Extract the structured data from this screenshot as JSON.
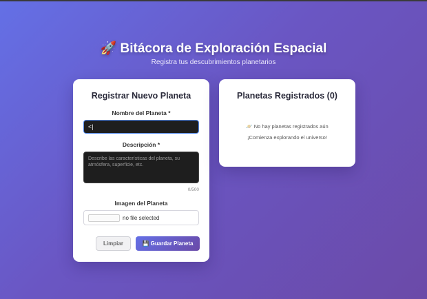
{
  "header": {
    "title": "🚀 Bitácora de Exploración Espacial",
    "subtitle": "Registra tus descubrimientos planetarios"
  },
  "form": {
    "heading": "Registrar Nuevo Planeta",
    "name_label": "Nombre del Planeta *",
    "name_value": "<|",
    "description_label": "Descripción *",
    "description_placeholder": "Describe las características del planeta, su atmósfera, superficie, etc.",
    "char_counter": "0/500",
    "image_label": "Imagen del Planeta",
    "file_status": "no file selected",
    "clear_label": "Limpiar",
    "save_label": "💾 Guardar Planeta"
  },
  "list": {
    "heading": "Planetas Registrados (0)",
    "empty_message": "🪐 No hay planetas registrados aún",
    "empty_sub": "¡Comienza explorando el universo!"
  },
  "colors": {
    "accent": "#6470e6",
    "accent_dark": "#6a4aa8",
    "focus_border": "#4f86e8"
  }
}
